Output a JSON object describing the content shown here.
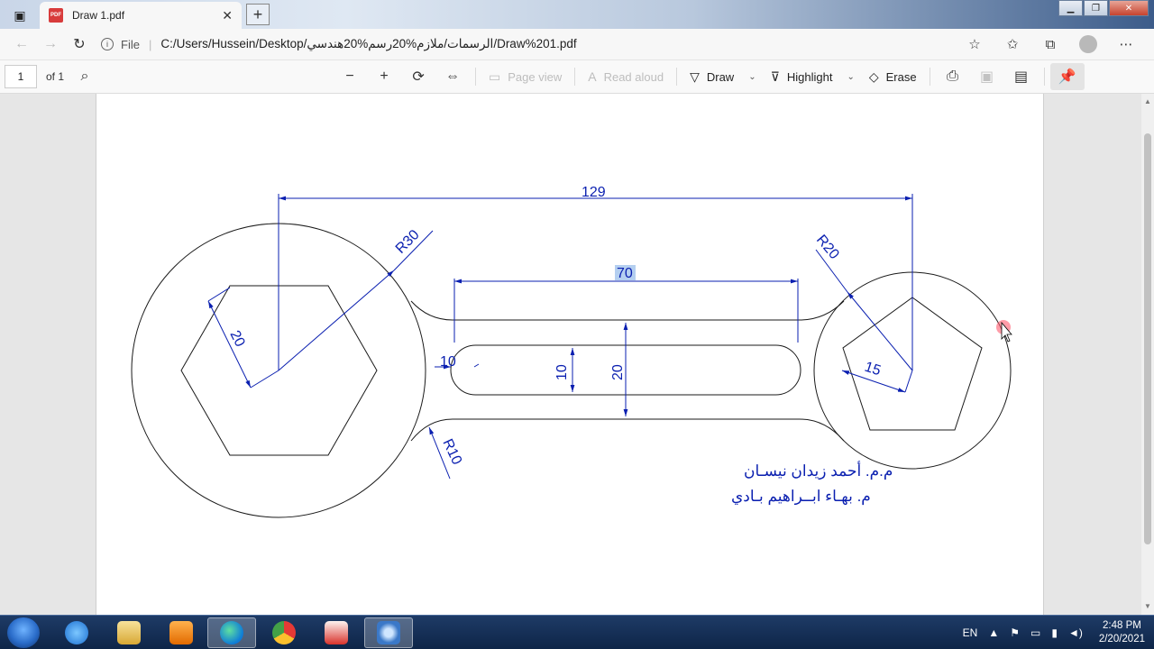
{
  "browser": {
    "tab_title": "Draw 1.pdf",
    "pdf_badge": "PDF",
    "url_scheme": "File",
    "url": "C:/Users/Hussein/Desktop/الرسمات/ملازم%20رسم%20هندسي/Draw%201.pdf"
  },
  "pdf_toolbar": {
    "page_number": "1",
    "page_count": "of 1",
    "page_view": "Page view",
    "read_aloud": "Read aloud",
    "draw": "Draw",
    "highlight": "Highlight",
    "erase": "Erase"
  },
  "drawing": {
    "dim_overall": "129",
    "dim_slot_length": "70",
    "dim_r30": "R30",
    "dim_r20": "R20",
    "dim_r10": "R10",
    "dim_hex": "20",
    "dim_pent": "15",
    "dim_10_left": "10",
    "dim_10_vert": "10",
    "dim_20_vert": "20",
    "author_1": "م.م. أحمد زيدان نيسـان",
    "author_2": "م. بهـاء ابــراهيم بـادي",
    "line_color": "#1a1a1a",
    "dim_color": "#0a1fb0"
  },
  "taskbar": {
    "language": "EN",
    "time": "2:48 PM",
    "date": "2/20/2021"
  },
  "icons": {
    "tab_menu": "window-icon",
    "back": "back-arrow-icon",
    "forward": "forward-arrow-icon",
    "refresh": "refresh-icon",
    "info": "info-icon",
    "favorite_add": "star-add-icon",
    "favorites": "favorites-icon",
    "collections": "collections-icon",
    "more": "more-icon"
  }
}
